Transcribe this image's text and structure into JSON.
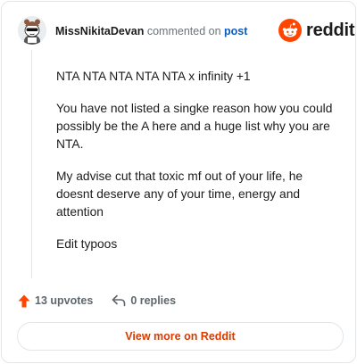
{
  "comment": {
    "username": "MissNikitaDevan",
    "commented_on": "commented on",
    "post_link": "post",
    "paragraphs": [
      "NTA NTA NTA NTA NTA x infinity +1",
      "You have not listed a singke reason how you could possibly be the A here and a huge list why you are NTA.",
      "My advise cut that toxic mf out of your life, he doesnt deserve any of your time, energy and attention",
      "Edit typoos"
    ]
  },
  "brand": {
    "name": "reddit",
    "accent_color": "#FF4500"
  },
  "actions": {
    "upvotes": "13 upvotes",
    "replies": "0 replies"
  },
  "view_more_label": "View more on Reddit",
  "icons": {
    "avatar": "snoo-avatar",
    "logo": "reddit-logo-icon",
    "upvote": "upvote-arrow-icon",
    "reply": "reply-arrow-icon"
  }
}
